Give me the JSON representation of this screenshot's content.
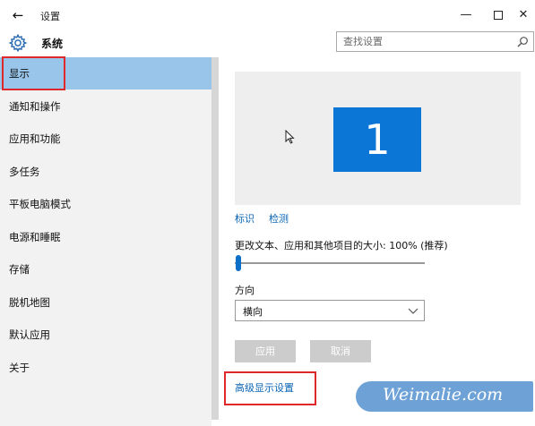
{
  "titlebar": {
    "back_glyph": "←",
    "title": "设置",
    "minimize_glyph": "—",
    "close_glyph": "✕"
  },
  "header": {
    "icon": "gear-icon",
    "title": "系统",
    "search": {
      "placeholder": "查找设置",
      "value": ""
    }
  },
  "sidebar": {
    "items": [
      {
        "label": "显示",
        "selected": true
      },
      {
        "label": "通知和操作"
      },
      {
        "label": "应用和功能"
      },
      {
        "label": "多任务"
      },
      {
        "label": "平板电脑模式"
      },
      {
        "label": "电源和睡眠"
      },
      {
        "label": "存储"
      },
      {
        "label": "脱机地图"
      },
      {
        "label": "默认应用"
      },
      {
        "label": "关于"
      }
    ]
  },
  "main": {
    "monitor_number": "1",
    "links": {
      "identify": "标识",
      "detect": "检测"
    },
    "scale": {
      "label": "更改文本、应用和其他项目的大小: 100% (推荐)",
      "value_percent": 100
    },
    "orientation": {
      "label": "方向",
      "value": "横向"
    },
    "buttons": {
      "apply": "应用",
      "cancel": "取消",
      "apply_enabled": false,
      "cancel_enabled": false
    },
    "advanced_link": "高级显示设置"
  },
  "watermark": {
    "text": "Weimalie.com"
  },
  "colors": {
    "accent": "#0b76d6",
    "selected_nav": "#98c5e9",
    "highlight_box": "#e0282a",
    "link": "#0a64b4"
  }
}
